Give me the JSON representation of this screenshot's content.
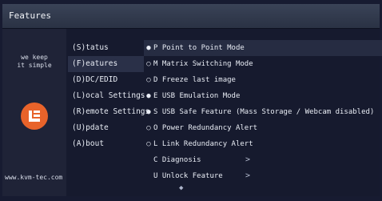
{
  "window": {
    "title": "Features"
  },
  "brand": {
    "slogan_line1": "we keep",
    "slogan_line2": "it simple",
    "website": "www.kvm-tec.com",
    "logo_color": "#e8632a"
  },
  "main_menu": [
    {
      "label": "(S)tatus"
    },
    {
      "label": "(F)eatures",
      "selected": true
    },
    {
      "label": "(D)DC/EDID"
    },
    {
      "label": "(L)ocal  Settings"
    },
    {
      "label": "(R)emote Settings"
    },
    {
      "label": "(U)pdate"
    },
    {
      "label": "(A)bout"
    }
  ],
  "features": [
    {
      "bullet": "●",
      "label": "P Point to Point Mode",
      "active": true
    },
    {
      "bullet": "○",
      "label": "M Matrix Switching Mode"
    },
    {
      "bullet": "○",
      "label": "D Freeze last image"
    },
    {
      "bullet": "●",
      "label": "E USB Emulation Mode",
      "active": true
    },
    {
      "bullet": "●",
      "label": "S USB Safe Feature (Mass Storage / Webcam disabled)",
      "active": true
    },
    {
      "bullet": "○",
      "label": "O Power Redundancy Alert"
    },
    {
      "bullet": "○",
      "label": "L Link Redundancy Alert"
    },
    {
      "bullet": "",
      "label": "C Diagnosis",
      "arrow": ">"
    },
    {
      "bullet": "",
      "label": "U Unlock Feature",
      "arrow": ">"
    }
  ],
  "scroll_indicator": "◆"
}
